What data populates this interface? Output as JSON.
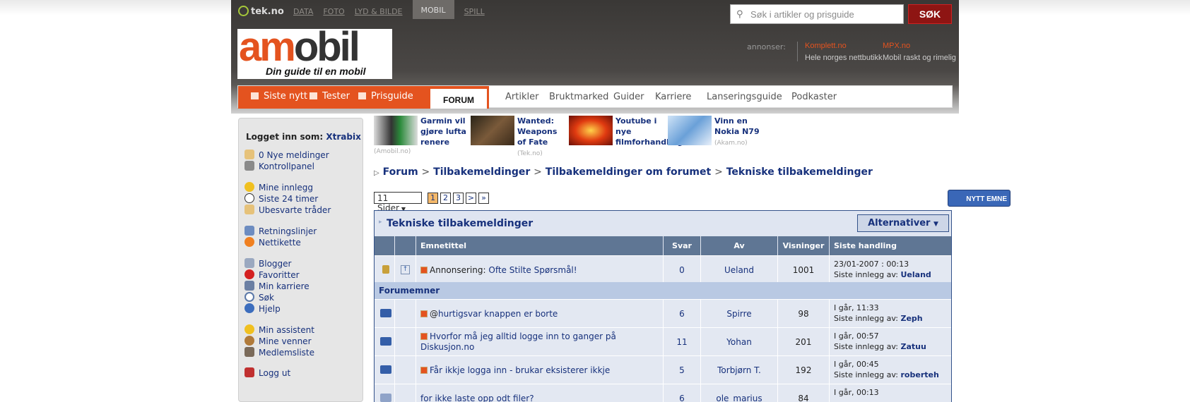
{
  "top": {
    "brand": "tek.no",
    "sites": [
      "DATA",
      "FOTO",
      "LYD & BILDE",
      "MOBIL",
      "SPILL"
    ],
    "active_site": "MOBIL",
    "search_placeholder": "Søk i artikler og prisguide",
    "search_button": "SØK"
  },
  "logo": {
    "text_a": "am",
    "text_b": "obil",
    "tagline": "Din guide til en mobil hverdag"
  },
  "ads": {
    "label": "annonser:",
    "items": [
      {
        "name": "Komplett.no",
        "sub": "Hele norges nettbutikk"
      },
      {
        "name": "MPX.no",
        "sub": "Mobil raskt og rimelig"
      }
    ]
  },
  "mainnav": {
    "items": [
      "Siste nytt",
      "Tester",
      "Prisguide"
    ],
    "active": "FORUM",
    "sub": [
      "Artikler",
      "Bruktmarked",
      "Guider",
      "Karriere",
      "Lanseringsguide",
      "Podkaster"
    ]
  },
  "sidebar": {
    "logged_in_label": "Logget inn som:",
    "user": "Xtrabix",
    "items": [
      "0 Nye meldinger",
      "Kontrollpanel",
      "Mine innlegg",
      "Siste 24 timer",
      "Ubesvarte tråder",
      "Retningslinjer",
      "Nettikette",
      "Blogger",
      "Favoritter",
      "Min karriere",
      "Søk",
      "Hjelp",
      "Min assistent",
      "Mine venner",
      "Medlemsliste",
      "Logg ut"
    ]
  },
  "news": [
    {
      "title": "Garmin vil gjøre lufta renere",
      "source": "(Amobil.no)"
    },
    {
      "title": "Wanted: Weapons of Fate",
      "source": "(Tek.no)"
    },
    {
      "title": "Youtube i nye filmforhandlinger",
      "source": ""
    },
    {
      "title": "Vinn en Nokia N79",
      "source": "(Akam.no)"
    }
  ],
  "breadcrumb": [
    "Forum",
    "Tilbakemeldinger",
    "Tilbakemeldinger om forumet",
    "Tekniske tilbakemeldinger"
  ],
  "pagination": {
    "pages_label": "11 Sider",
    "pages": [
      "1",
      "2",
      "3",
      ">",
      "»"
    ],
    "current": "1"
  },
  "new_topic": "NYTT EMNE",
  "forum": {
    "title": "Tekniske tilbakemeldinger",
    "options": "Alternativer",
    "columns": [
      "Emnetittel",
      "Svar",
      "Av",
      "Visninger",
      "Siste handling"
    ],
    "announcement": {
      "prefix": "Annonsering:",
      "title": "Ofte Stilte Spørsmål!",
      "replies": "0",
      "author": "Ueland",
      "views": "1001",
      "last_time": "23/01-2007 : 00:13",
      "last_label": "Siste innlegg av:",
      "last_user": "Ueland"
    },
    "section": "Forumemner",
    "topics": [
      {
        "title": "hurtigsvar knappen er borte",
        "replies": "6",
        "author": "Spirre",
        "views": "98",
        "last_time": "I går, 11:33",
        "last_label": "Siste innlegg av:",
        "last_user": "Zeph"
      },
      {
        "title": "Hvorfor må jeg alltid logge inn to ganger på Diskusjon.no",
        "replies": "11",
        "author": "Yohan",
        "views": "201",
        "last_time": "I går, 00:57",
        "last_label": "Siste innlegg av:",
        "last_user": "Zatuu"
      },
      {
        "title": "Får ikkje logga inn - brukar eksisterer ikkje",
        "replies": "5",
        "author": "Torbjørn T.",
        "views": "192",
        "last_time": "I går, 00:45",
        "last_label": "Siste innlegg av:",
        "last_user": "roberteh"
      },
      {
        "title": "for ikke laste opp odt filer?",
        "replies": "6",
        "author": "ole_marius",
        "views": "84",
        "last_time": "I går, 00:13",
        "last_label": "",
        "last_user": ""
      }
    ]
  },
  "colors": {
    "accent": "#e4531f",
    "link": "#17317c",
    "header": "#5f7694"
  }
}
